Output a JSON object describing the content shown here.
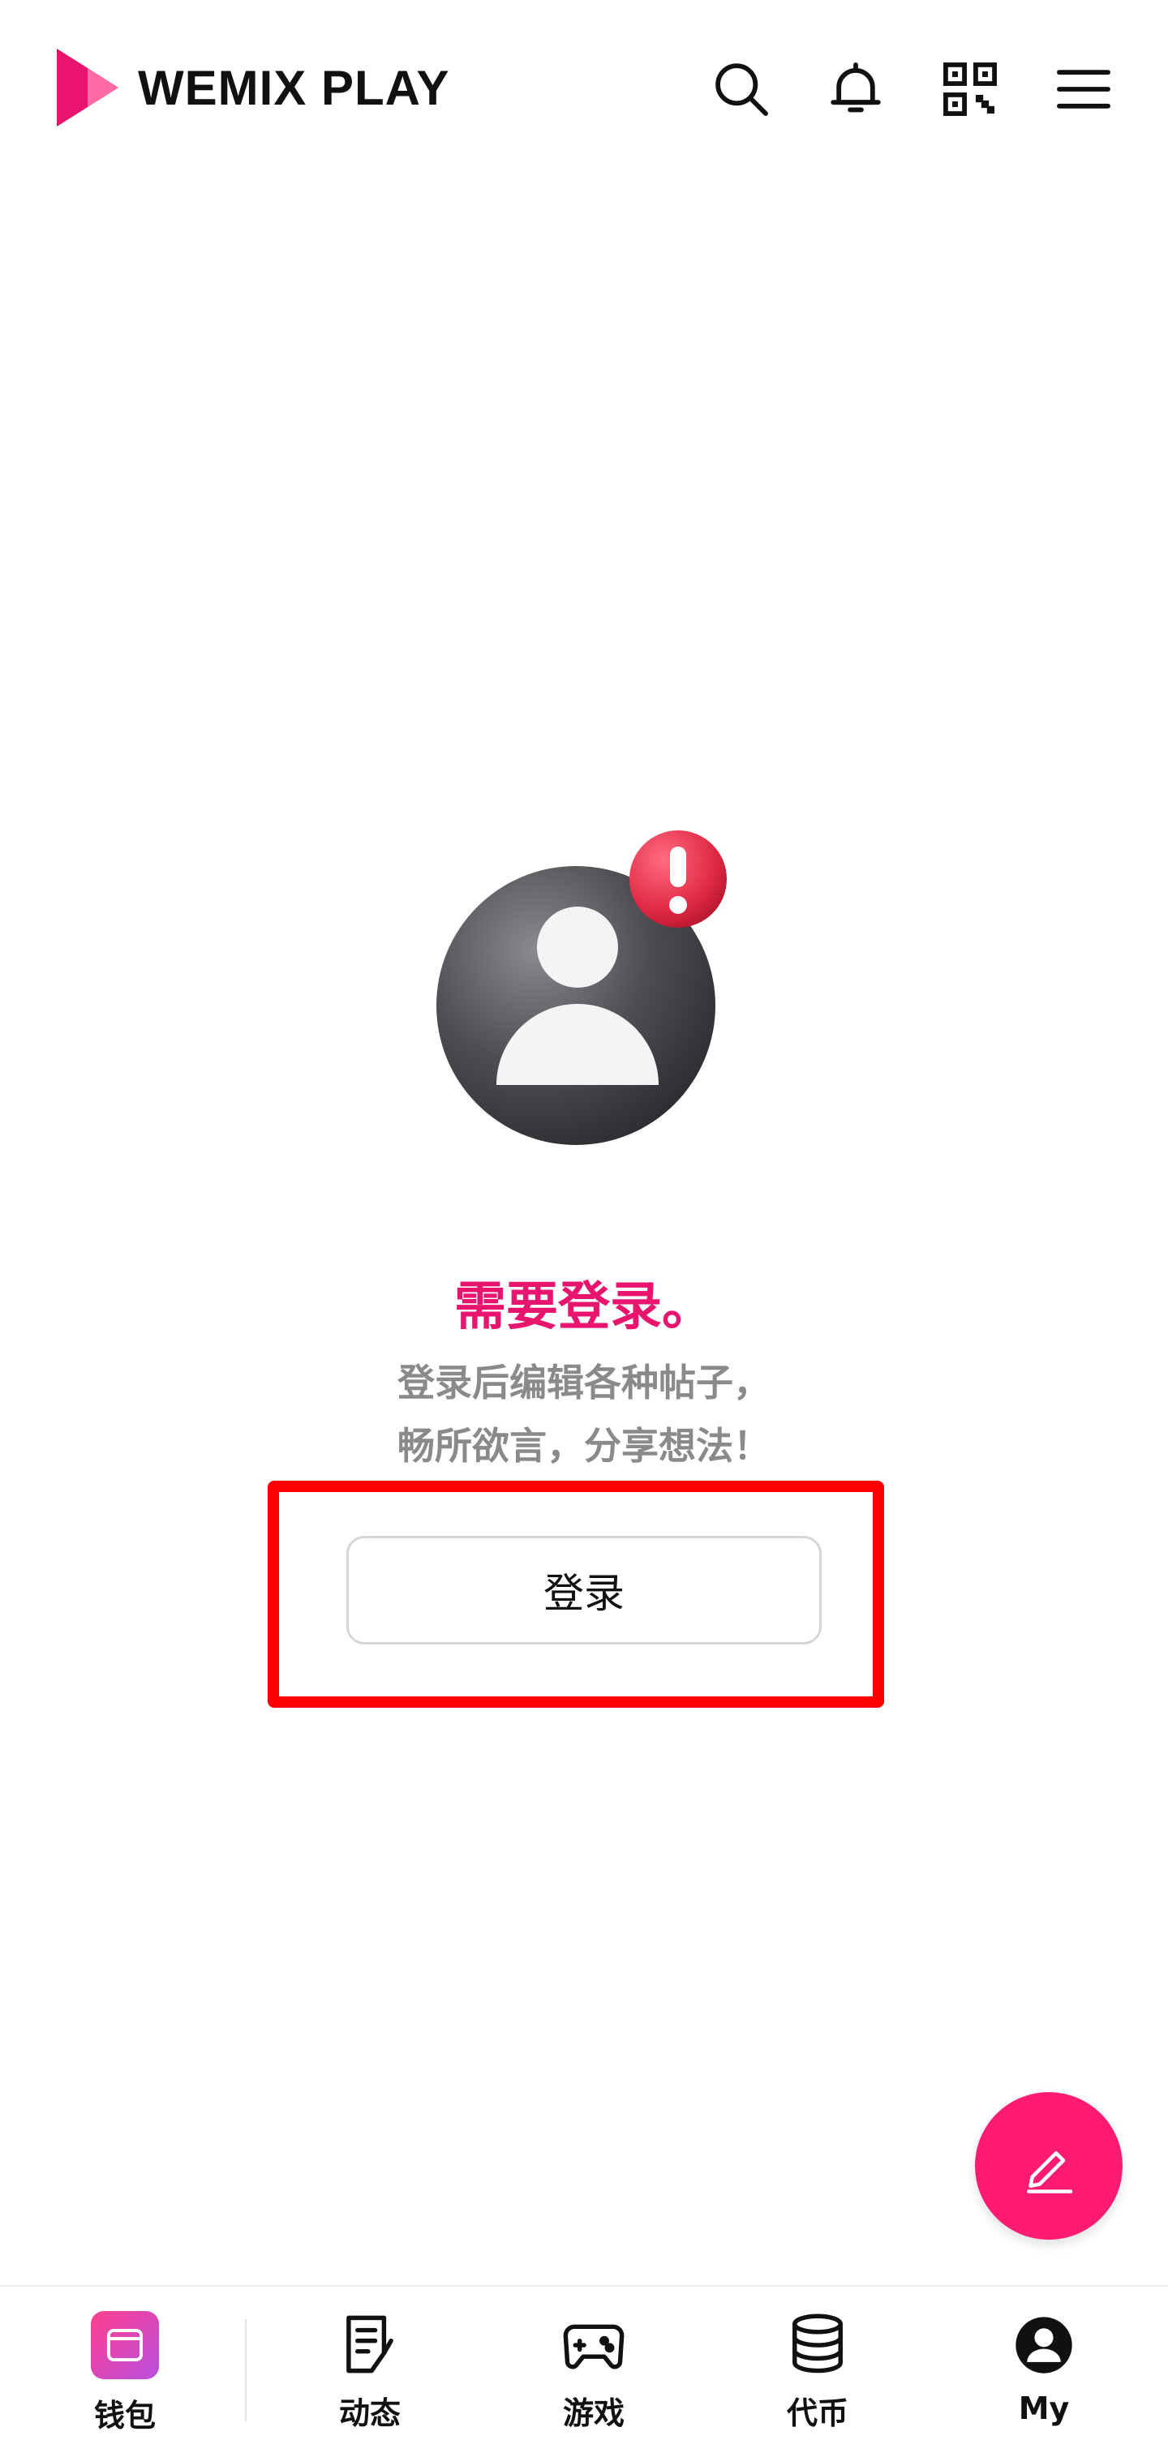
{
  "header": {
    "logo_text": "WEMIX PLAY",
    "brand_color": "#e8146e",
    "icons": [
      "search-icon",
      "bell-icon",
      "qr-code-icon",
      "menu-icon"
    ]
  },
  "empty_state": {
    "title": "需要登录。",
    "desc_line1": "登录后编辑各种帖子，",
    "desc_line2": "畅所欲言，分享想法！",
    "login_button": "登录",
    "highlight_color": "#ff0000"
  },
  "fab": {
    "icon": "edit-icon",
    "color": "#ff1a72"
  },
  "bottom_nav": {
    "items": [
      {
        "label": "钱包",
        "icon": "wallet-icon"
      },
      {
        "label": "动态",
        "icon": "feed-icon"
      },
      {
        "label": "游戏",
        "icon": "gamepad-icon"
      },
      {
        "label": "代币",
        "icon": "coins-icon"
      },
      {
        "label": "My",
        "icon": "user-icon"
      }
    ]
  }
}
